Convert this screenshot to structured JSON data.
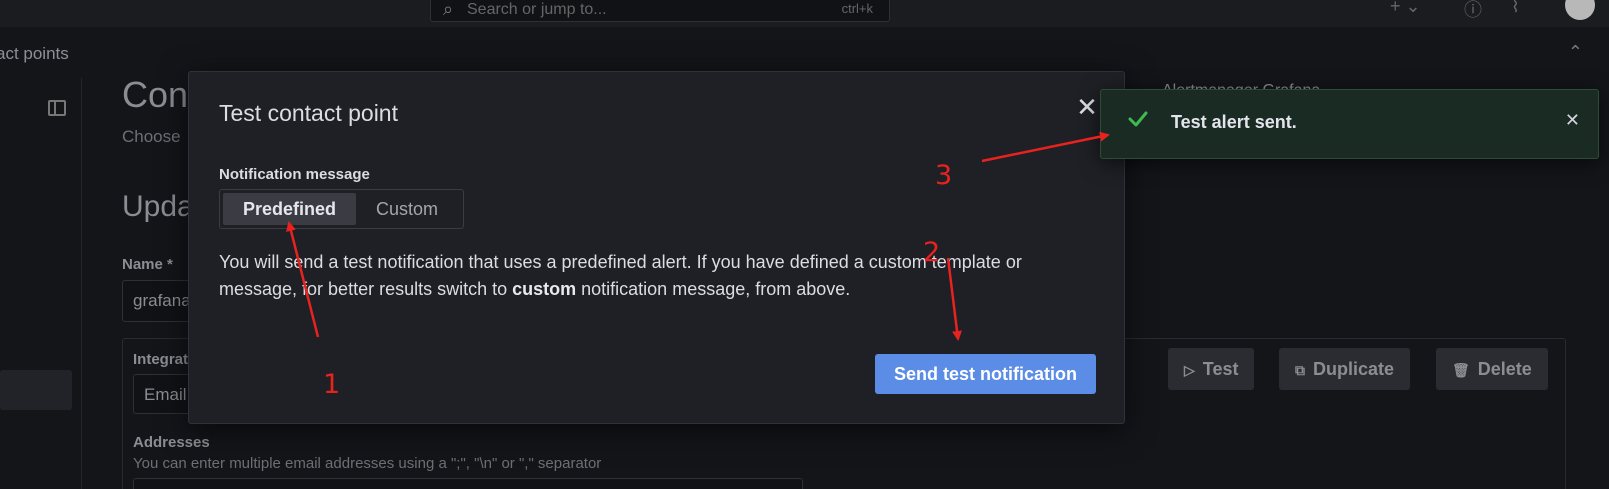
{
  "topbar": {
    "search_placeholder": "Search or jump to...",
    "search_shortcut": "ctrl+k",
    "plus_icon": "+ ⌄",
    "help_icon": "?",
    "news_icon": "rss"
  },
  "subbar": {
    "breadcrumb": "act points"
  },
  "background_page": {
    "title": "Con",
    "subtitle": "Choose",
    "section_title": "Upda",
    "name_label": "Name *",
    "name_value": "grafana",
    "integration_label": "Integrat",
    "integration_value": "Email",
    "addresses_label": "Addresses",
    "addresses_help": "You can enter multiple email addresses using a \";\", \"\\n\" or \",\" separator",
    "test_button": "Test",
    "duplicate_button": "Duplicate",
    "delete_button": "Delete",
    "header_crumbs": "Alertmanager  Grafana"
  },
  "modal": {
    "title": "Test contact point",
    "notification_label": "Notification message",
    "options": [
      "Predefined",
      "Custom"
    ],
    "selected_option": "Predefined",
    "description_part1": "You will send a test notification that uses a predefined alert. If you have defined a custom template or message, for better results switch to ",
    "description_bold": "custom",
    "description_part2": " notification message, from above.",
    "send_button": "Send test notification"
  },
  "toast": {
    "message": "Test alert sent.",
    "status": "success",
    "accent_color": "#3fb950"
  },
  "annotations": {
    "labels": [
      "1",
      "2",
      "3"
    ],
    "color": "#e8231f"
  }
}
